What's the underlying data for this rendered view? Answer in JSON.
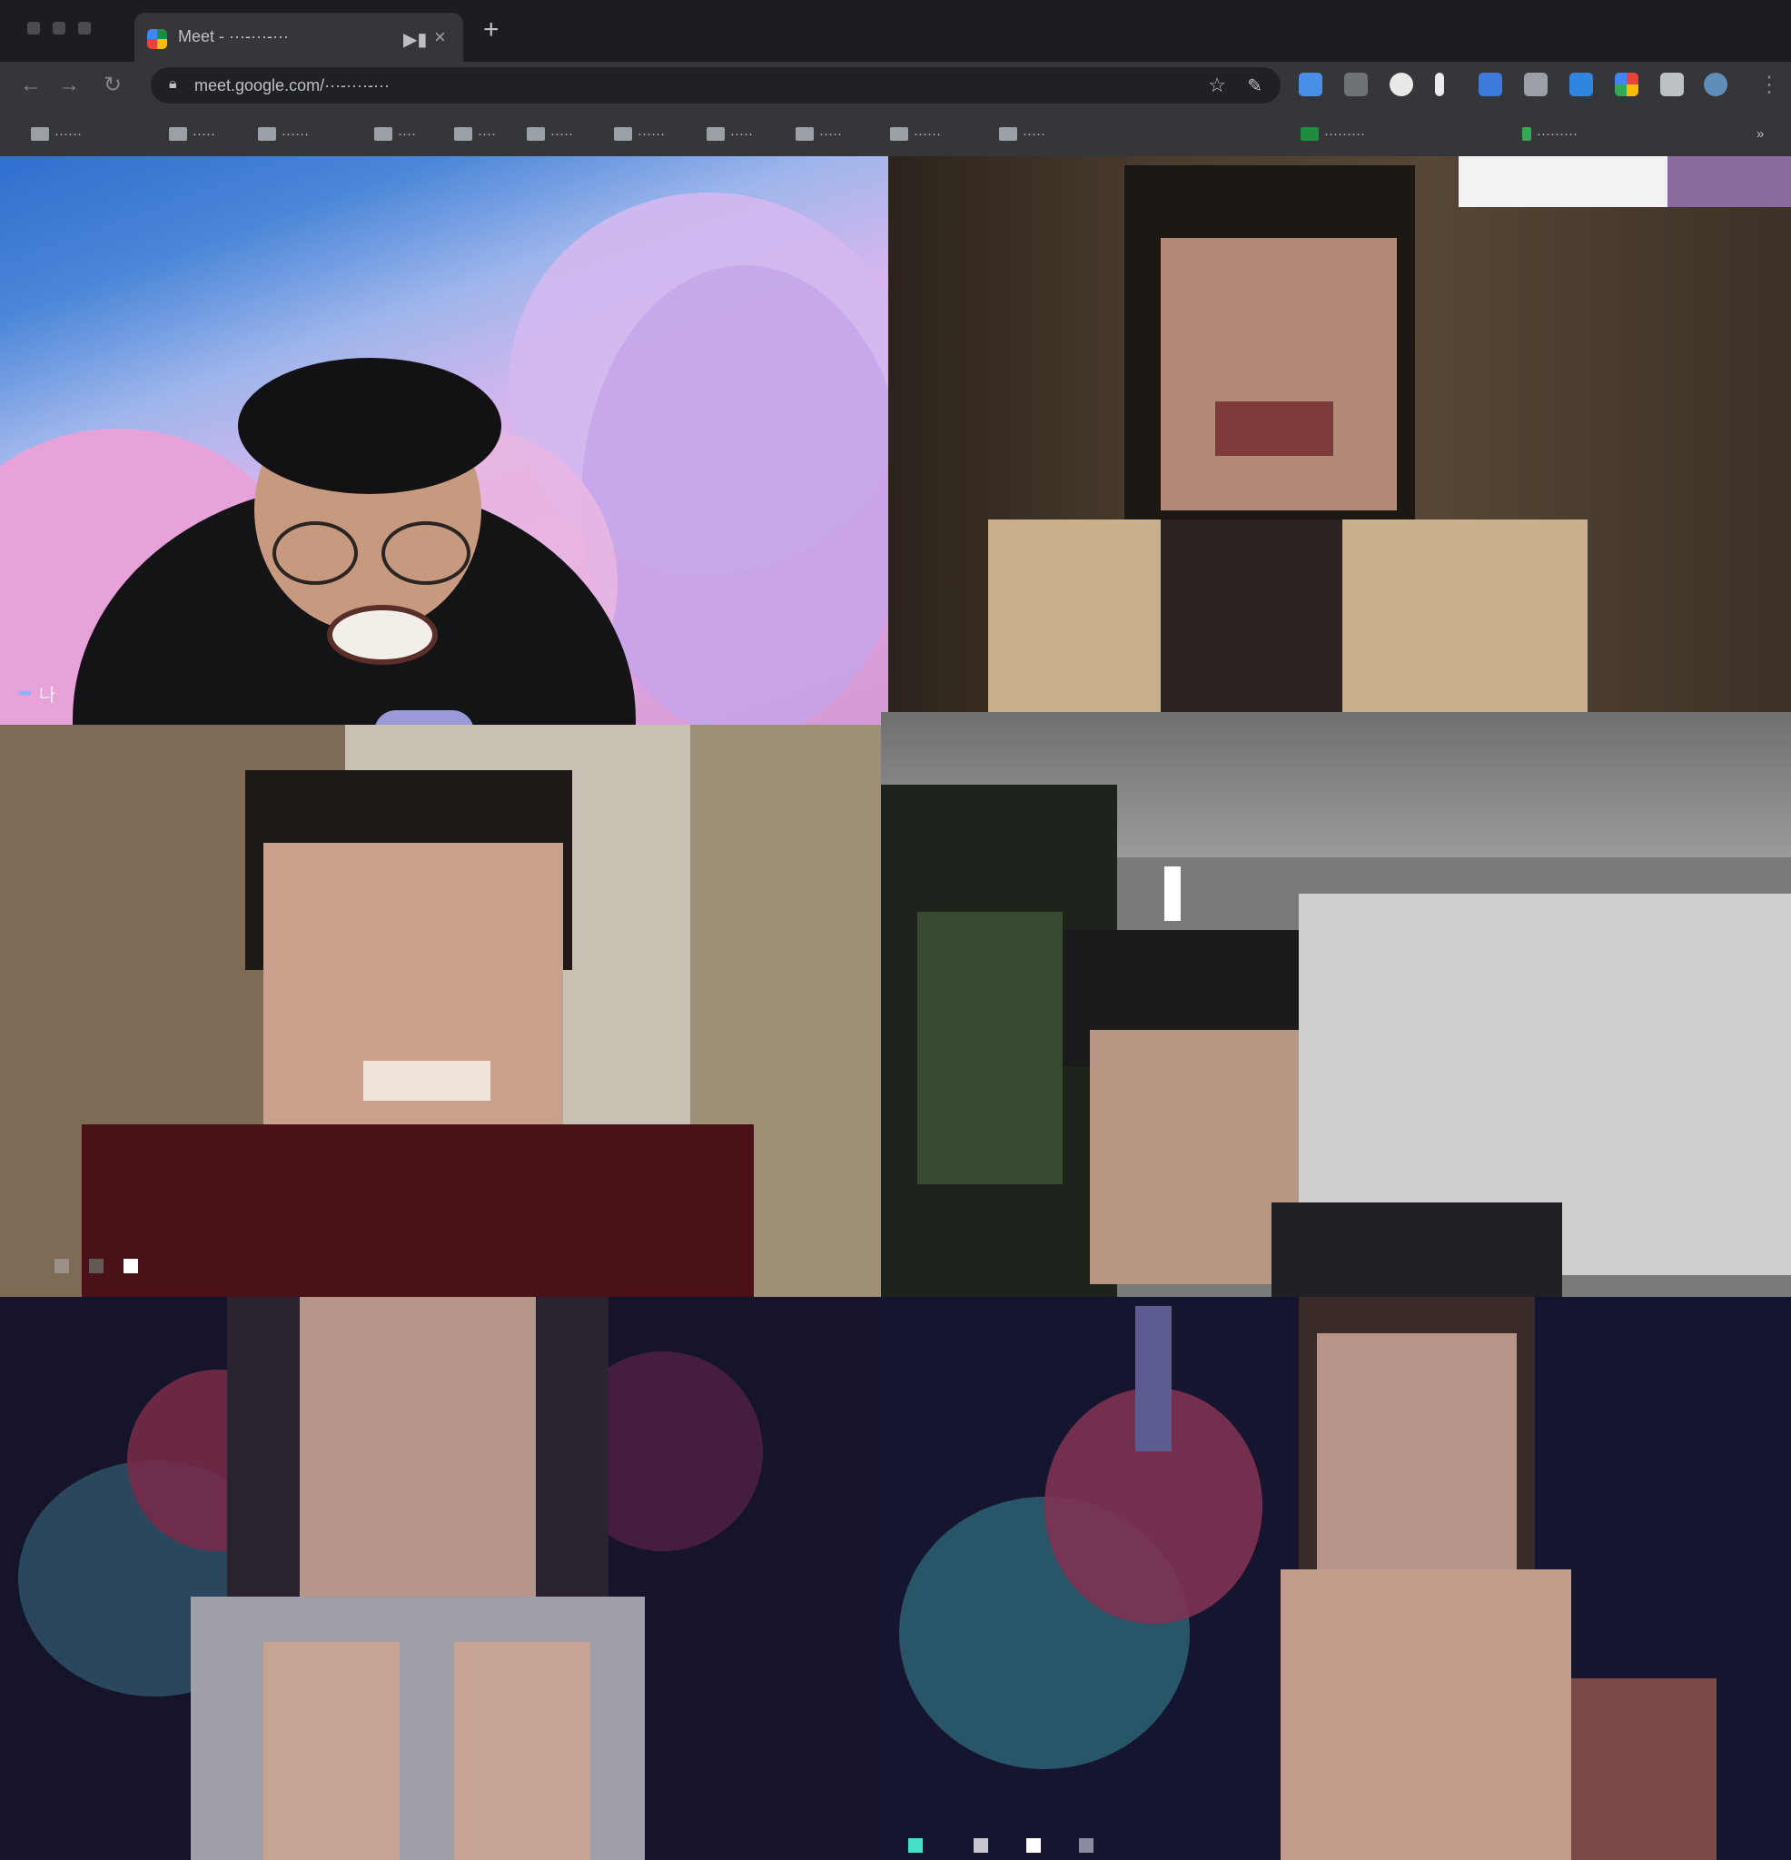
{
  "browser": {
    "tab": {
      "title": "Meet - ···-···-···",
      "record_icon": "record-icon",
      "close_icon": "close-icon"
    },
    "new_tab_label": "+",
    "address_bar": {
      "url": "meet.google.com/···-····-···"
    },
    "extensions": [
      "ext-arrow-icon",
      "ext-mail-icon",
      "ext-heart-icon",
      "ext-bookmark-icon",
      "ext-translate-icon",
      "ext-clipboard-icon",
      "ext-window-icon",
      "ext-grid-icon",
      "ext-cast-icon",
      "ext-globe-icon"
    ],
    "bookmarks": [
      "······",
      "·····",
      "······",
      "····",
      "····",
      "·····",
      "······",
      "·····",
      "·····",
      "······",
      "·····",
      "·········",
      "·········"
    ]
  },
  "meeting": {
    "self_tile": {
      "name": "나",
      "more_icon": "more-options-icon"
    },
    "participants": [
      "participant-2",
      "participant-3",
      "participant-4",
      "participant-5",
      "participant-6"
    ],
    "colors": {
      "sky": "#3a78d0",
      "cloud_pink": "#e6a6dc",
      "cloud_violet": "#c9a6e6",
      "accent_dots": "#8ab4f8",
      "tile_teal": "#46e0c8"
    }
  }
}
